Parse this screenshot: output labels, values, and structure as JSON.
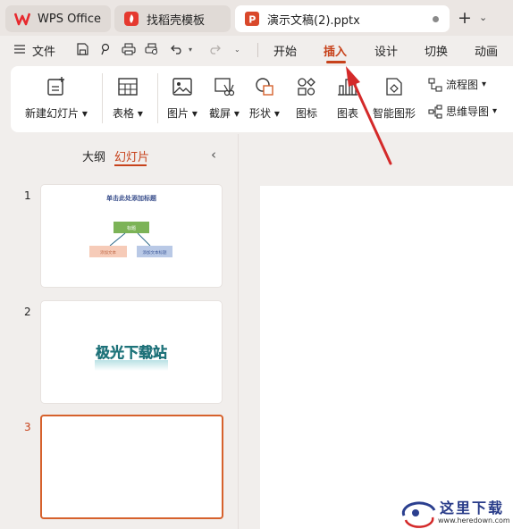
{
  "tabs": [
    {
      "label": "WPS Office",
      "icon": "wps-logo-icon"
    },
    {
      "label": "找稻壳模板",
      "icon": "docer-flame-icon"
    },
    {
      "label": "演示文稿(2).pptx",
      "icon": "presentation-p-icon",
      "active": true,
      "unsaved": true
    }
  ],
  "menu": {
    "file_label": "文件",
    "tabs": [
      "开始",
      "插入",
      "设计",
      "切换",
      "动画"
    ],
    "active_tab": "插入"
  },
  "ribbon": {
    "new_slide": "新建幻灯片",
    "table": "表格",
    "picture": "图片",
    "screenshot": "截屏",
    "shape": "形状",
    "icon": "图标",
    "chart": "图表",
    "smartart": "智能图形",
    "flowchart": "流程图",
    "mindmap": "思维导图"
  },
  "panel": {
    "tab_outline": "大纲",
    "tab_slides": "幻灯片",
    "active_tab": "幻灯片"
  },
  "slides": [
    {
      "number": "1",
      "title": "单击此处添加标题",
      "top_node": "标题",
      "left_node": "添加文本",
      "right_node": "添加文本标题"
    },
    {
      "number": "2",
      "text": "极光下载站"
    },
    {
      "number": "3",
      "selected": true
    }
  ],
  "watermark": {
    "text": "这里下载",
    "url": "www.heredown.com"
  },
  "colors": {
    "accent": "#c7421b",
    "arrow": "#d42a2a",
    "wps_red": "#e7292e",
    "node_green": "#7cb357",
    "node_pink": "#f6cbb8",
    "node_blue": "#b9c9e6"
  }
}
